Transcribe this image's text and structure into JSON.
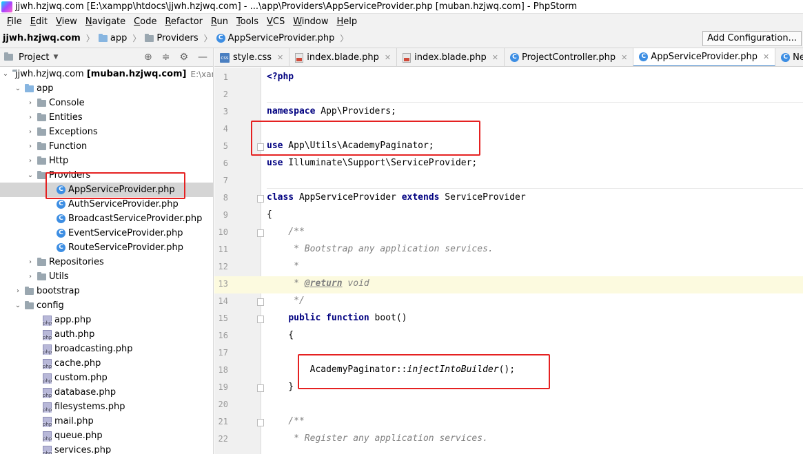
{
  "window": {
    "title": "jjwh.hzjwq.com [E:\\xampp\\htdocs\\jjwh.hzjwq.com] - ...\\app\\Providers\\AppServiceProvider.php [muban.hzjwq.com] - PhpStorm"
  },
  "menu": [
    {
      "u": "F",
      "rest": "ile"
    },
    {
      "u": "E",
      "rest": "dit"
    },
    {
      "u": "V",
      "rest": "iew"
    },
    {
      "u": "N",
      "rest": "avigate"
    },
    {
      "u": "C",
      "rest": "ode"
    },
    {
      "u": "R",
      "rest": "efactor"
    },
    {
      "u": "R",
      "rest": "un"
    },
    {
      "u": "T",
      "rest": "ools"
    },
    {
      "u": "V",
      "rest": "CS"
    },
    {
      "u": "W",
      "rest": "indow"
    },
    {
      "u": "H",
      "rest": "elp"
    }
  ],
  "breadcrumb": {
    "root": "jjwh.hzjwq.com",
    "app": "app",
    "providers": "Providers",
    "file": "AppServiceProvider.php"
  },
  "toolbar": {
    "add_configuration": "Add Configuration..."
  },
  "project_panel": {
    "title": "Project",
    "root_label": "jjwh.hzjwq.com",
    "root_module": "[muban.hzjwq.com]",
    "root_path": "E:\\xampp",
    "app": "app",
    "console": "Console",
    "entities": "Entities",
    "exceptions": "Exceptions",
    "function": "Function",
    "http": "Http",
    "providers": "Providers",
    "app_service_provider": "AppServiceProvider.php",
    "auth_service_provider": "AuthServiceProvider.php",
    "broadcast_service_provider": "BroadcastServiceProvider.php",
    "event_service_provider": "EventServiceProvider.php",
    "route_service_provider": "RouteServiceProvider.php",
    "repositories": "Repositories",
    "utils": "Utils",
    "bootstrap": "bootstrap",
    "config": "config",
    "config_files": [
      "app.php",
      "auth.php",
      "broadcasting.php",
      "cache.php",
      "custom.php",
      "database.php",
      "filesystems.php",
      "mail.php",
      "queue.php",
      "services.php"
    ]
  },
  "tabs": [
    {
      "label": "style.css",
      "icon": "css-icon"
    },
    {
      "label": "index.blade.php",
      "icon": "blade-icon"
    },
    {
      "label": "index.blade.php",
      "icon": "blade-icon"
    },
    {
      "label": "ProjectController.php",
      "icon": "class-icon"
    },
    {
      "label": "AppServiceProvider.php",
      "icon": "class-icon",
      "active": true
    },
    {
      "label": "NewsController.",
      "icon": "class-icon"
    }
  ],
  "editor": {
    "line_numbers": [
      "1",
      "2",
      "3",
      "4",
      "5",
      "6",
      "7",
      "8",
      "9",
      "10",
      "11",
      "12",
      "13",
      "14",
      "15",
      "16",
      "17",
      "18",
      "19",
      "20",
      "21",
      "22"
    ],
    "l1": "<?php",
    "l3_kw": "namespace",
    "l3_rest": " App\\Providers;",
    "l5_kw": "use",
    "l5_rest": " App\\Utils\\AcademyPaginator;",
    "l6_kw": "use",
    "l6_rest": " Illuminate\\Support\\ServiceProvider;",
    "l8_kw1": "class",
    "l8_mid": " AppServiceProvider ",
    "l8_kw2": "extends",
    "l8_rest": " ServiceProvider",
    "l9": "{",
    "l10": "    /**",
    "l11": "     * Bootstrap any application services.",
    "l12": "     *",
    "l13_pre": "     * ",
    "l13_tag": "@return",
    "l13_rest": " void",
    "l14": "     */",
    "l15_pre": "    ",
    "l15_kw1": "public",
    "l15_sp": " ",
    "l15_kw2": "function",
    "l15_rest": " boot()",
    "l16": "    {",
    "l18_pre": "        AcademyPaginator::",
    "l18_fn": "injectIntoBuilder",
    "l18_rest": "();",
    "l19": "    }",
    "l21": "    /**",
    "l22": "     * Register any application services."
  }
}
